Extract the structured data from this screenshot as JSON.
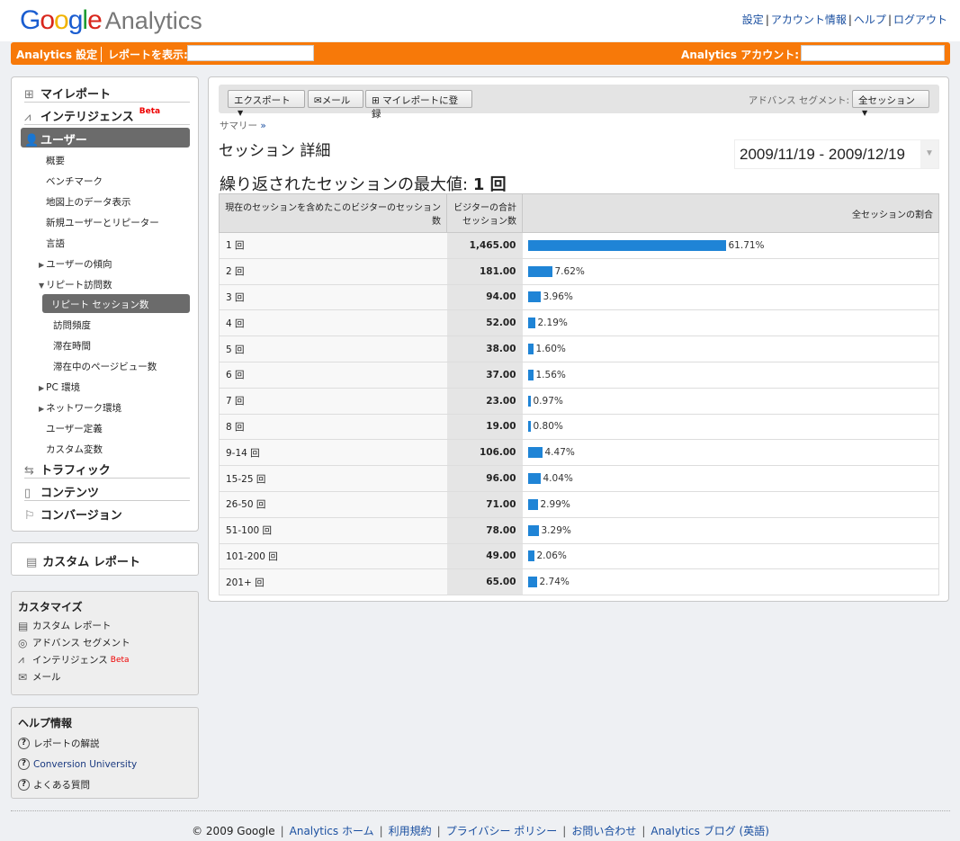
{
  "header": {
    "logo_google": "Google",
    "logo_analytics": "Analytics",
    "links": [
      "設定",
      "アカウント情報",
      "ヘルプ",
      "ログアウト"
    ]
  },
  "orange": {
    "settings": "Analytics 設定",
    "report_label": "レポートを表示:",
    "account_label": "Analytics アカウント:"
  },
  "sidebar": {
    "my_report": "マイレポート",
    "intelligence": "インテリジェンス",
    "beta": "Beta",
    "users": "ユーザー",
    "subs": [
      "概要",
      "ベンチマーク",
      "地図上のデータ表示",
      "新規ユーザーとリピーター",
      "言語",
      "ユーザーの傾向",
      "リピート訪問数",
      "リピート セッション数",
      "訪問頻度",
      "滞在時間",
      "滞在中のページビュー数",
      "PC 環境",
      "ネットワーク環境",
      "ユーザー定義",
      "カスタム変数"
    ],
    "traffic": "トラフィック",
    "content": "コンテンツ",
    "conversion": "コンバージョン"
  },
  "custom_report": "カスタム レポート",
  "customize": {
    "title": "カスタマイズ",
    "items": [
      "カスタム レポート",
      "アドバンス セグメント",
      "インテリジェンス",
      "メール"
    ],
    "beta": "Beta"
  },
  "help": {
    "title": "ヘルプ情報",
    "items": [
      "レポートの解説",
      "Conversion University",
      "よくある質問"
    ]
  },
  "toolbar": {
    "export": "エクスポート",
    "mail": "メール",
    "add_report": "マイレポートに登録",
    "segment_label": "アドバンス セグメント:",
    "segment_value": "全セッション"
  },
  "breadcrumb": "サマリー",
  "breadcrumb_arrow": "»",
  "page_title": "セッション 詳細",
  "date_range": "2009/11/19 - 2009/12/19",
  "subtitle": "繰り返されたセッションの最大値:",
  "subtitle_value": "1 回",
  "table": {
    "headers": [
      "現在のセッションを含めたこのビジターのセッション数",
      "ビジターの合計セッション数",
      "全セッションの割合"
    ],
    "rows": [
      {
        "label": "1 回",
        "value": "1,465.00",
        "pct": 61.71
      },
      {
        "label": "2 回",
        "value": "181.00",
        "pct": 7.62
      },
      {
        "label": "3 回",
        "value": "94.00",
        "pct": 3.96
      },
      {
        "label": "4 回",
        "value": "52.00",
        "pct": 2.19
      },
      {
        "label": "5 回",
        "value": "38.00",
        "pct": 1.6
      },
      {
        "label": "6 回",
        "value": "37.00",
        "pct": 1.56
      },
      {
        "label": "7 回",
        "value": "23.00",
        "pct": 0.97
      },
      {
        "label": "8 回",
        "value": "19.00",
        "pct": 0.8
      },
      {
        "label": "9-14 回",
        "value": "106.00",
        "pct": 4.47
      },
      {
        "label": "15-25 回",
        "value": "96.00",
        "pct": 4.04
      },
      {
        "label": "26-50 回",
        "value": "71.00",
        "pct": 2.99
      },
      {
        "label": "51-100 回",
        "value": "78.00",
        "pct": 3.29
      },
      {
        "label": "101-200 回",
        "value": "49.00",
        "pct": 2.06
      },
      {
        "label": "201+ 回",
        "value": "65.00",
        "pct": 2.74
      }
    ]
  },
  "footer": {
    "copyright": "© 2009 Google",
    "links": [
      "Analytics ホーム",
      "利用規約",
      "プライバシー ポリシー",
      "お問い合わせ",
      "Analytics ブログ (英語)"
    ]
  },
  "colors": {
    "orange": "#f77909",
    "bar": "#1f84d6"
  }
}
